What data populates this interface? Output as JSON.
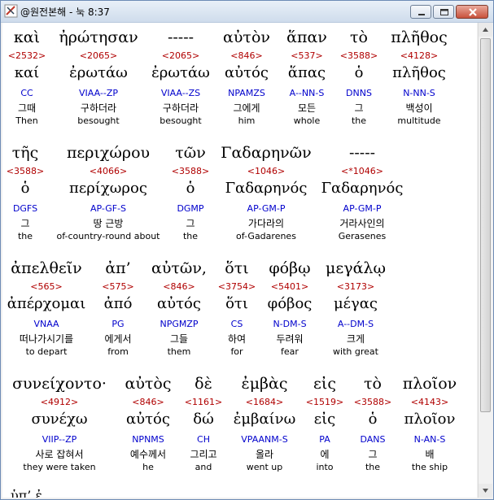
{
  "window": {
    "title": "@원전본해 - 눅 8:37"
  },
  "rows": [
    [
      {
        "greek": "καὶ",
        "strong": "<2532>",
        "lemma": "καί",
        "parse": "CC",
        "korean": "그때",
        "english": "Then"
      },
      {
        "greek": "ἠρώτησαν",
        "strong": "<2065>",
        "lemma": "ἐρωτάω",
        "parse": "VIAA--ZP",
        "korean": "구하더라",
        "english": "besought"
      },
      {
        "greek": "-----",
        "strong": "<2065>",
        "lemma": "ἐρωτάω",
        "parse": "VIAA--ZS",
        "korean": "구하더라",
        "english": "besought"
      },
      {
        "greek": "αὐτὸν",
        "strong": "<846>",
        "lemma": "αὐτός",
        "parse": "NPAMZS",
        "korean": "그에게",
        "english": "him"
      },
      {
        "greek": "ἅπαν",
        "strong": "<537>",
        "lemma": "ἅπας",
        "parse": "A--NN-S",
        "korean": "모든",
        "english": "whole"
      },
      {
        "greek": "τὸ",
        "strong": "<3588>",
        "lemma": "ὁ",
        "parse": "DNNS",
        "korean": "그",
        "english": "the"
      },
      {
        "greek": "πλῆθος",
        "strong": "<4128>",
        "lemma": "πλῆθος",
        "parse": "N-NN-S",
        "korean": "백성이",
        "english": "multitude"
      }
    ],
    [
      {
        "greek": "τῆς",
        "strong": "<3588>",
        "lemma": "ὁ",
        "parse": "DGFS",
        "korean": "그",
        "english": "the"
      },
      {
        "greek": "περιχώρου",
        "strong": "<4066>",
        "lemma": "περίχωρος",
        "parse": "AP-GF-S",
        "korean": "땅 근방",
        "english": "of-country-round about"
      },
      {
        "greek": "τῶν",
        "strong": "<3588>",
        "lemma": "ὁ",
        "parse": "DGMP",
        "korean": "그",
        "english": "the"
      },
      {
        "greek": "Γαδαρηνῶν",
        "strong": "<1046>",
        "lemma": "Γαδαρηνός",
        "parse": "AP-GM-P",
        "korean": "가다라의",
        "english": "of-Gadarenes"
      },
      {
        "greek": "-----",
        "strong": "<*1046>",
        "lemma": "Γαδαρηνός",
        "parse": "AP-GM-P",
        "korean": "거라사인의",
        "english": "Gerasenes"
      }
    ],
    [
      {
        "greek": "ἀπελθεῖν",
        "strong": "<565>",
        "lemma": "ἀπέρχομαι",
        "parse": "VNAA",
        "korean": "떠나가시기를",
        "english": "to depart"
      },
      {
        "greek": "ἀπ’",
        "strong": "<575>",
        "lemma": "ἀπό",
        "parse": "PG",
        "korean": "에게서",
        "english": "from"
      },
      {
        "greek": "αὐτῶν,",
        "strong": "<846>",
        "lemma": "αὐτός",
        "parse": "NPGMZP",
        "korean": "그들",
        "english": "them"
      },
      {
        "greek": "ὅτι",
        "strong": "<3754>",
        "lemma": "ὅτι",
        "parse": "CS",
        "korean": "하여",
        "english": "for"
      },
      {
        "greek": "φόβῳ",
        "strong": "<5401>",
        "lemma": "φόβος",
        "parse": "N-DM-S",
        "korean": "두려워",
        "english": "fear"
      },
      {
        "greek": "μεγάλῳ",
        "strong": "<3173>",
        "lemma": "μέγας",
        "parse": "A--DM-S",
        "korean": "크게",
        "english": "with great"
      }
    ],
    [
      {
        "greek": "συνείχοντο·",
        "strong": "<4912>",
        "lemma": "συνέχω",
        "parse": "VIIP--ZP",
        "korean": "사로 잡혀서",
        "english": "they were taken"
      },
      {
        "greek": "αὐτὸς",
        "strong": "<846>",
        "lemma": "αὐτός",
        "parse": "NPNMS",
        "korean": "예수께서",
        "english": "he"
      },
      {
        "greek": "δὲ",
        "strong": "<1161>",
        "lemma": "δώ",
        "parse": "CH",
        "korean": "그리고",
        "english": "and"
      },
      {
        "greek": "ἐμβὰς",
        "strong": "<1684>",
        "lemma": "ἐμβαίνω",
        "parse": "VPAANM-S",
        "korean": "올라",
        "english": "went up"
      },
      {
        "greek": "εἰς",
        "strong": "<1519>",
        "lemma": "εἰς",
        "parse": "PA",
        "korean": "에",
        "english": "into"
      },
      {
        "greek": "τὸ",
        "strong": "<3588>",
        "lemma": "ὁ",
        "parse": "DANS",
        "korean": "그",
        "english": "the"
      },
      {
        "greek": "πλοῖον",
        "strong": "<4143>",
        "lemma": "πλοῖον",
        "parse": "N-AN-S",
        "korean": "배",
        "english": "the ship"
      }
    ]
  ],
  "partial_row_text": "ὑπ’ ἐ"
}
